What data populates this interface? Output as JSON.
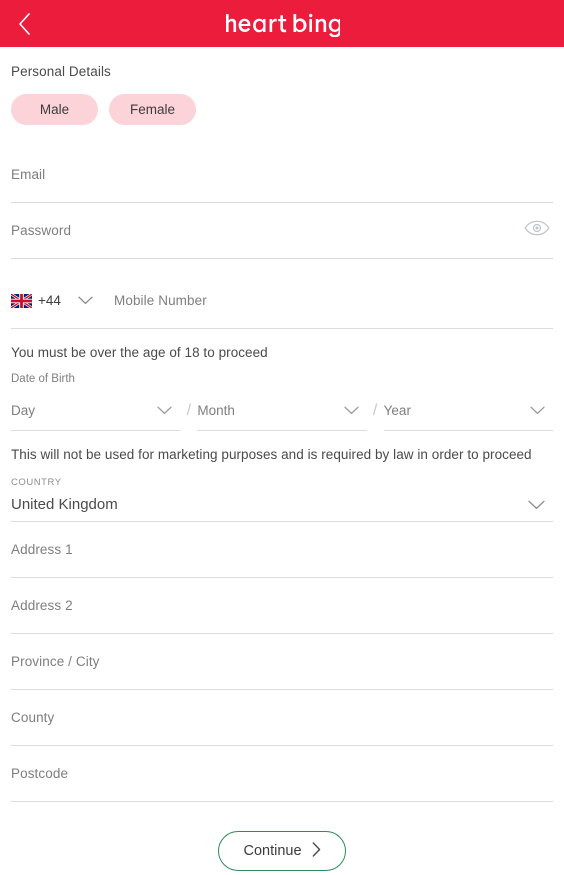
{
  "header": {
    "back_icon": "chevron-left-icon",
    "logo_text": "heart Bingo",
    "logo_word1": "heart",
    "logo_word2": "Bingo",
    "background_color": "#ec1d3c"
  },
  "form": {
    "section_title": "Personal Details",
    "gender": {
      "male_label": "Male",
      "female_label": "Female",
      "pill_color": "#fbd3d9"
    },
    "email": {
      "placeholder": "Email"
    },
    "password": {
      "placeholder": "Password",
      "toggle_icon": "eye-icon"
    },
    "phone": {
      "flag": "uk-flag-icon",
      "dial_code": "+44",
      "dropdown_icon": "chevron-down-icon",
      "placeholder": "Mobile Number"
    },
    "age_note": "You must be over the age of 18 to proceed",
    "dob": {
      "label": "Date of Birth",
      "day_placeholder": "Day",
      "month_placeholder": "Month",
      "year_placeholder": "Year",
      "separator": "/"
    },
    "marketing_note": "This will not be used for marketing purposes and is required by law in order to proceed",
    "country": {
      "label": "COUNTRY",
      "value": "United Kingdom",
      "dropdown_icon": "chevron-down-icon"
    },
    "address": {
      "address1_placeholder": "Address 1",
      "address2_placeholder": "Address 2",
      "city_placeholder": "Province / City",
      "county_placeholder": "County",
      "postcode_placeholder": "Postcode"
    },
    "continue": {
      "label": "Continue",
      "icon": "chevron-right-icon",
      "border_color": "#2f8a55"
    }
  }
}
